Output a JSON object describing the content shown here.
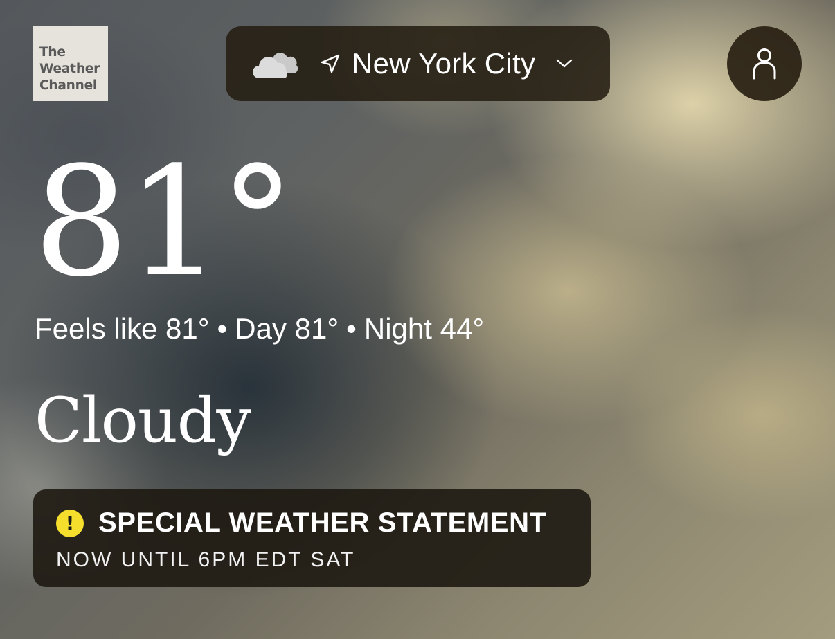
{
  "header": {
    "logo_lines": [
      "The",
      "Weather",
      "Channel"
    ],
    "location": {
      "city": "New York City",
      "weather_icon": "cloudy-icon",
      "location_icon": "navigation-arrow-icon",
      "dropdown_icon": "chevron-down-icon"
    },
    "profile_icon": "user-icon"
  },
  "current": {
    "temperature": "81°",
    "feels_like_text": "Feels like 81°",
    "day_text": "Day 81°",
    "night_text": "Night 44°",
    "separator": "•",
    "condition": "Cloudy"
  },
  "alert": {
    "icon": "exclamation-icon",
    "icon_glyph": "!",
    "title": "SPECIAL WEATHER STATEMENT",
    "subtitle": "NOW UNTIL 6PM EDT SAT",
    "icon_color": "#f5df2c"
  }
}
